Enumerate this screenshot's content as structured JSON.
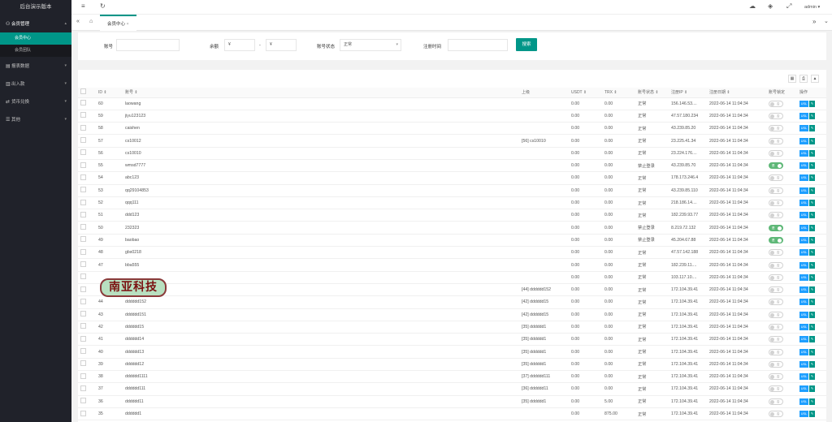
{
  "sidebar": {
    "title": "后台演示版本",
    "items": [
      {
        "label": "会员管理",
        "icon": "user-icon",
        "expanded": true,
        "children": [
          {
            "label": "会员中心",
            "active": true
          },
          {
            "label": "会员团队",
            "active": false
          }
        ]
      },
      {
        "label": "报表数据",
        "icon": "report-icon"
      },
      {
        "label": "出入款",
        "icon": "money-icon"
      },
      {
        "label": "货币兑换",
        "icon": "exchange-icon"
      },
      {
        "label": "其他",
        "icon": "other-icon"
      }
    ]
  },
  "topbar": {
    "user": "admin"
  },
  "tabs": [
    {
      "label": "会员中心"
    }
  ],
  "search": {
    "account_label": "账号",
    "account_value": "",
    "amount_label": "余额",
    "amount_from": "¥",
    "amount_sep": "-",
    "amount_to": "¥",
    "status_label": "账号状态",
    "status_value": "正常",
    "reg_label": "注册时间",
    "reg_value": "",
    "search_button": "搜索"
  },
  "table": {
    "headers": [
      "ID",
      "账号",
      "上级",
      "USDT",
      "TRX",
      "账号状态",
      "注册IP",
      "注册日期",
      "账号锁定",
      "操作"
    ],
    "switch_off_label": "否",
    "switch_on_label": "是",
    "op_label": "USL",
    "edit_label": "✎",
    "rows": [
      {
        "id": "60",
        "account": "laowang",
        "parent": "",
        "usdt": "0.00",
        "trx": "0.00",
        "status": "正常",
        "ip": "156.146.53....",
        "date": "2022-06-14 11:04:34",
        "locked": false
      },
      {
        "id": "59",
        "account": "jiyu123123",
        "parent": "",
        "usdt": "0.00",
        "trx": "0.00",
        "status": "正常",
        "ip": "47.57.180.234",
        "date": "2022-06-14 11:04:34",
        "locked": false
      },
      {
        "id": "58",
        "account": "caishen",
        "parent": "",
        "usdt": "0.00",
        "trx": "0.00",
        "status": "正常",
        "ip": "43.239.85.20",
        "date": "2022-06-14 11:04:34",
        "locked": false
      },
      {
        "id": "57",
        "account": "cs10012",
        "parent": "[56] cs10010",
        "usdt": "0.00",
        "trx": "0.00",
        "status": "正常",
        "ip": "23.225.41.34",
        "date": "2022-06-14 11:04:34",
        "locked": false
      },
      {
        "id": "56",
        "account": "cs10010",
        "parent": "",
        "usdt": "0.00",
        "trx": "0.00",
        "status": "正常",
        "ip": "23.224.176....",
        "date": "2022-06-14 11:04:34",
        "locked": false
      },
      {
        "id": "55",
        "account": "wmsd7777",
        "parent": "",
        "usdt": "0.00",
        "trx": "0.00",
        "status": "禁止登录",
        "ip": "43.239.85.70",
        "date": "2022-06-14 11:04:34",
        "locked": true
      },
      {
        "id": "54",
        "account": "abc123",
        "parent": "",
        "usdt": "0.00",
        "trx": "0.00",
        "status": "正常",
        "ip": "178.173.246.4",
        "date": "2022-06-14 11:04:34",
        "locked": false
      },
      {
        "id": "53",
        "account": "qq29104853",
        "parent": "",
        "usdt": "0.00",
        "trx": "0.00",
        "status": "正常",
        "ip": "43.239.85.110",
        "date": "2022-06-14 11:04:34",
        "locked": false
      },
      {
        "id": "52",
        "account": "qqq111",
        "parent": "",
        "usdt": "0.00",
        "trx": "0.00",
        "status": "正常",
        "ip": "218.186.14....",
        "date": "2022-06-14 11:04:34",
        "locked": false
      },
      {
        "id": "51",
        "account": "ddd123",
        "parent": "",
        "usdt": "0.00",
        "trx": "0.00",
        "status": "正常",
        "ip": "182.239.93.77",
        "date": "2022-06-14 11:04:34",
        "locked": false
      },
      {
        "id": "50",
        "account": "232323",
        "parent": "",
        "usdt": "0.00",
        "trx": "0.00",
        "status": "禁止登录",
        "ip": "8.219.72.132",
        "date": "2022-06-14 11:04:34",
        "locked": true
      },
      {
        "id": "49",
        "account": "baobao",
        "parent": "",
        "usdt": "0.00",
        "trx": "0.00",
        "status": "禁止登录",
        "ip": "45.204.67.88",
        "date": "2022-06-14 11:04:34",
        "locked": true
      },
      {
        "id": "48",
        "account": "gbs0218",
        "parent": "",
        "usdt": "0.00",
        "trx": "0.00",
        "status": "正常",
        "ip": "47.57.142.188",
        "date": "2022-06-14 11:04:34",
        "locked": false
      },
      {
        "id": "47",
        "account": "bba555",
        "parent": "",
        "usdt": "0.00",
        "trx": "0.00",
        "status": "正常",
        "ip": "182.239.11....",
        "date": "2022-06-14 11:04:34",
        "locked": false
      },
      {
        "id": "",
        "account": "",
        "parent": "",
        "usdt": "0.00",
        "trx": "0.00",
        "status": "正常",
        "ip": "103.117.10....",
        "date": "2022-06-14 11:04:34",
        "locked": false
      },
      {
        "id": "",
        "account": "",
        "parent": "[44] dddddd152",
        "usdt": "0.00",
        "trx": "0.00",
        "status": "正常",
        "ip": "172.104.39.41",
        "date": "2022-06-14 11:04:34",
        "locked": false
      },
      {
        "id": "44",
        "account": "dddddd152",
        "parent": "[42] dddddd15",
        "usdt": "0.00",
        "trx": "0.00",
        "status": "正常",
        "ip": "172.104.39.41",
        "date": "2022-06-14 11:04:34",
        "locked": false
      },
      {
        "id": "43",
        "account": "dddddd151",
        "parent": "[42] dddddd15",
        "usdt": "0.00",
        "trx": "0.00",
        "status": "正常",
        "ip": "172.104.39.41",
        "date": "2022-06-14 11:04:34",
        "locked": false
      },
      {
        "id": "42",
        "account": "dddddd15",
        "parent": "[35] dddddd1",
        "usdt": "0.00",
        "trx": "0.00",
        "status": "正常",
        "ip": "172.104.39.41",
        "date": "2022-06-14 11:04:34",
        "locked": false
      },
      {
        "id": "41",
        "account": "dddddd14",
        "parent": "[35] dddddd1",
        "usdt": "0.00",
        "trx": "0.00",
        "status": "正常",
        "ip": "172.104.39.41",
        "date": "2022-06-14 11:04:34",
        "locked": false
      },
      {
        "id": "40",
        "account": "dddddd13",
        "parent": "[35] dddddd1",
        "usdt": "0.00",
        "trx": "0.00",
        "status": "正常",
        "ip": "172.104.39.41",
        "date": "2022-06-14 11:04:34",
        "locked": false
      },
      {
        "id": "39",
        "account": "dddddd12",
        "parent": "[35] dddddd1",
        "usdt": "0.00",
        "trx": "0.00",
        "status": "正常",
        "ip": "172.104.39.41",
        "date": "2022-06-14 11:04:34",
        "locked": false
      },
      {
        "id": "38",
        "account": "dddddd1111",
        "parent": "[37] dddddd111",
        "usdt": "0.00",
        "trx": "0.00",
        "status": "正常",
        "ip": "172.104.39.41",
        "date": "2022-06-14 11:04:34",
        "locked": false
      },
      {
        "id": "37",
        "account": "dddddd111",
        "parent": "[36] dddddd11",
        "usdt": "0.00",
        "trx": "0.00",
        "status": "正常",
        "ip": "172.104.39.41",
        "date": "2022-06-14 11:04:34",
        "locked": false
      },
      {
        "id": "36",
        "account": "dddddd11",
        "parent": "[35] dddddd1",
        "usdt": "0.00",
        "trx": "5.00",
        "status": "正常",
        "ip": "172.104.39.41",
        "date": "2022-06-14 11:04:34",
        "locked": false
      },
      {
        "id": "35",
        "account": "dddddd1",
        "parent": "",
        "usdt": "0.00",
        "trx": "875.00",
        "status": "正常",
        "ip": "172.104.39.41",
        "date": "2022-06-14 11:04:34",
        "locked": false
      }
    ]
  },
  "watermark": "南亚科技"
}
